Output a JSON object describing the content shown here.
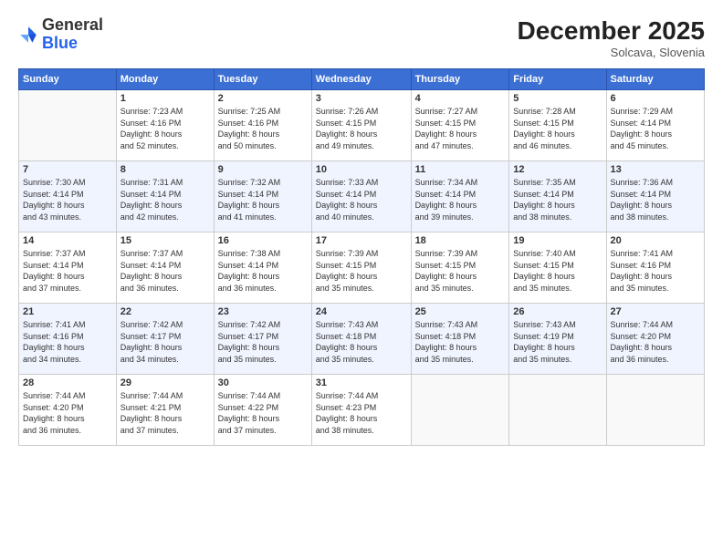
{
  "logo": {
    "general": "General",
    "blue": "Blue"
  },
  "title": "December 2025",
  "subtitle": "Solcava, Slovenia",
  "days_header": [
    "Sunday",
    "Monday",
    "Tuesday",
    "Wednesday",
    "Thursday",
    "Friday",
    "Saturday"
  ],
  "weeks": [
    [
      {
        "num": "",
        "info": ""
      },
      {
        "num": "1",
        "info": "Sunrise: 7:23 AM\nSunset: 4:16 PM\nDaylight: 8 hours\nand 52 minutes."
      },
      {
        "num": "2",
        "info": "Sunrise: 7:25 AM\nSunset: 4:16 PM\nDaylight: 8 hours\nand 50 minutes."
      },
      {
        "num": "3",
        "info": "Sunrise: 7:26 AM\nSunset: 4:15 PM\nDaylight: 8 hours\nand 49 minutes."
      },
      {
        "num": "4",
        "info": "Sunrise: 7:27 AM\nSunset: 4:15 PM\nDaylight: 8 hours\nand 47 minutes."
      },
      {
        "num": "5",
        "info": "Sunrise: 7:28 AM\nSunset: 4:15 PM\nDaylight: 8 hours\nand 46 minutes."
      },
      {
        "num": "6",
        "info": "Sunrise: 7:29 AM\nSunset: 4:14 PM\nDaylight: 8 hours\nand 45 minutes."
      }
    ],
    [
      {
        "num": "7",
        "info": "Sunrise: 7:30 AM\nSunset: 4:14 PM\nDaylight: 8 hours\nand 43 minutes."
      },
      {
        "num": "8",
        "info": "Sunrise: 7:31 AM\nSunset: 4:14 PM\nDaylight: 8 hours\nand 42 minutes."
      },
      {
        "num": "9",
        "info": "Sunrise: 7:32 AM\nSunset: 4:14 PM\nDaylight: 8 hours\nand 41 minutes."
      },
      {
        "num": "10",
        "info": "Sunrise: 7:33 AM\nSunset: 4:14 PM\nDaylight: 8 hours\nand 40 minutes."
      },
      {
        "num": "11",
        "info": "Sunrise: 7:34 AM\nSunset: 4:14 PM\nDaylight: 8 hours\nand 39 minutes."
      },
      {
        "num": "12",
        "info": "Sunrise: 7:35 AM\nSunset: 4:14 PM\nDaylight: 8 hours\nand 38 minutes."
      },
      {
        "num": "13",
        "info": "Sunrise: 7:36 AM\nSunset: 4:14 PM\nDaylight: 8 hours\nand 38 minutes."
      }
    ],
    [
      {
        "num": "14",
        "info": "Sunrise: 7:37 AM\nSunset: 4:14 PM\nDaylight: 8 hours\nand 37 minutes."
      },
      {
        "num": "15",
        "info": "Sunrise: 7:37 AM\nSunset: 4:14 PM\nDaylight: 8 hours\nand 36 minutes."
      },
      {
        "num": "16",
        "info": "Sunrise: 7:38 AM\nSunset: 4:14 PM\nDaylight: 8 hours\nand 36 minutes."
      },
      {
        "num": "17",
        "info": "Sunrise: 7:39 AM\nSunset: 4:15 PM\nDaylight: 8 hours\nand 35 minutes."
      },
      {
        "num": "18",
        "info": "Sunrise: 7:39 AM\nSunset: 4:15 PM\nDaylight: 8 hours\nand 35 minutes."
      },
      {
        "num": "19",
        "info": "Sunrise: 7:40 AM\nSunset: 4:15 PM\nDaylight: 8 hours\nand 35 minutes."
      },
      {
        "num": "20",
        "info": "Sunrise: 7:41 AM\nSunset: 4:16 PM\nDaylight: 8 hours\nand 35 minutes."
      }
    ],
    [
      {
        "num": "21",
        "info": "Sunrise: 7:41 AM\nSunset: 4:16 PM\nDaylight: 8 hours\nand 34 minutes."
      },
      {
        "num": "22",
        "info": "Sunrise: 7:42 AM\nSunset: 4:17 PM\nDaylight: 8 hours\nand 34 minutes."
      },
      {
        "num": "23",
        "info": "Sunrise: 7:42 AM\nSunset: 4:17 PM\nDaylight: 8 hours\nand 35 minutes."
      },
      {
        "num": "24",
        "info": "Sunrise: 7:43 AM\nSunset: 4:18 PM\nDaylight: 8 hours\nand 35 minutes."
      },
      {
        "num": "25",
        "info": "Sunrise: 7:43 AM\nSunset: 4:18 PM\nDaylight: 8 hours\nand 35 minutes."
      },
      {
        "num": "26",
        "info": "Sunrise: 7:43 AM\nSunset: 4:19 PM\nDaylight: 8 hours\nand 35 minutes."
      },
      {
        "num": "27",
        "info": "Sunrise: 7:44 AM\nSunset: 4:20 PM\nDaylight: 8 hours\nand 36 minutes."
      }
    ],
    [
      {
        "num": "28",
        "info": "Sunrise: 7:44 AM\nSunset: 4:20 PM\nDaylight: 8 hours\nand 36 minutes."
      },
      {
        "num": "29",
        "info": "Sunrise: 7:44 AM\nSunset: 4:21 PM\nDaylight: 8 hours\nand 37 minutes."
      },
      {
        "num": "30",
        "info": "Sunrise: 7:44 AM\nSunset: 4:22 PM\nDaylight: 8 hours\nand 37 minutes."
      },
      {
        "num": "31",
        "info": "Sunrise: 7:44 AM\nSunset: 4:23 PM\nDaylight: 8 hours\nand 38 minutes."
      },
      {
        "num": "",
        "info": ""
      },
      {
        "num": "",
        "info": ""
      },
      {
        "num": "",
        "info": ""
      }
    ]
  ]
}
